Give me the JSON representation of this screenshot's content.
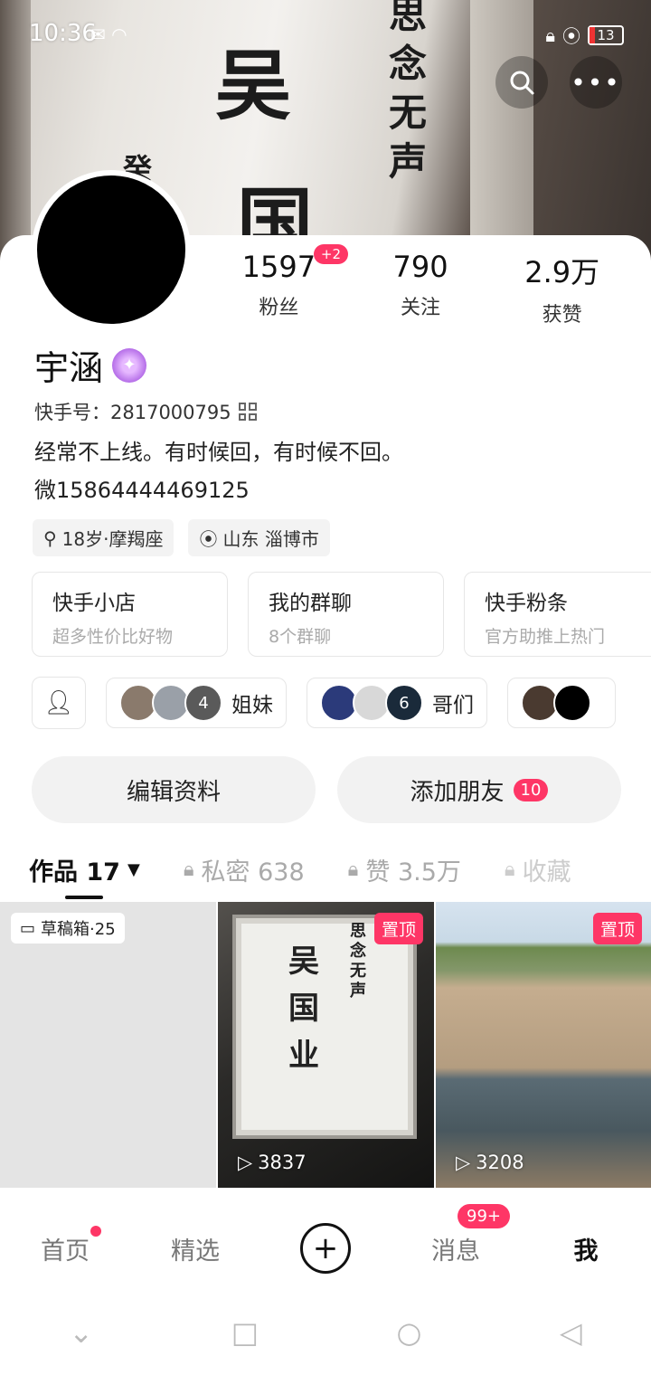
{
  "status_bar": {
    "time": "10:36",
    "battery": "13"
  },
  "stats": [
    {
      "num": "1597",
      "label": "粉丝",
      "badge": "+2"
    },
    {
      "num": "790",
      "label": "关注"
    },
    {
      "num": "2.9万",
      "label": "获赞"
    }
  ],
  "profile": {
    "name": "宇涵",
    "kuaishou_id": "快手号：2817000795",
    "bio_line1": "经常不上线。有时候回，有时候不回。",
    "bio_line2": "微15864444469125",
    "tags": [
      "18岁·摩羯座",
      "山东 淄博市"
    ]
  },
  "features": [
    {
      "title": "快手小店",
      "sub": "超多性价比好物"
    },
    {
      "title": "我的群聊",
      "sub": "8个群聊"
    },
    {
      "title": "快手粉条",
      "sub": "官方助推上热门"
    }
  ],
  "groups": [
    {
      "name": "姐妹",
      "count": "4"
    },
    {
      "name": "哥们",
      "count": "6"
    }
  ],
  "actions": {
    "edit": "编辑资料",
    "add_friends": "添加朋友",
    "add_friends_count": "10"
  },
  "tabs": [
    {
      "label": "作品 17"
    },
    {
      "label": "私密 638"
    },
    {
      "label": "赞 3.5万"
    },
    {
      "label": "收藏"
    }
  ],
  "grid": {
    "draft": "草稿箱·25",
    "pin_label": "置顶",
    "plays": [
      "3837",
      "3208"
    ]
  },
  "bottom_nav": [
    {
      "label": "首页"
    },
    {
      "label": "精选"
    },
    {
      "label": "+"
    },
    {
      "label": "消息",
      "badge": "99+"
    },
    {
      "label": "我"
    }
  ],
  "icons": {
    "search": "search-icon",
    "more": "more-icon",
    "qr": "qr-code-icon",
    "lock": "lock-icon",
    "play": "play-icon"
  },
  "colors": {
    "accent": "#fe3666"
  }
}
